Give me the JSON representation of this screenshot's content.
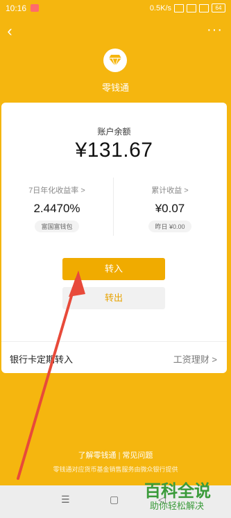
{
  "status_bar": {
    "time": "10:16",
    "network_speed": "0.5K/s",
    "battery": "64"
  },
  "header": {
    "back_icon": "chevron-left-icon",
    "more_icon": "more-dots-icon",
    "logo_icon": "diamond-icon",
    "title": "零钱通"
  },
  "balance": {
    "label": "账户余额",
    "value": "¥131.67"
  },
  "stats": {
    "yield_label": "7日年化收益率 >",
    "yield_value": "2.4470%",
    "fund_chip": "富国富钱包",
    "total_label": "累计收益 >",
    "total_value": "¥0.07",
    "yesterday_chip": "昨日 ¥0.00"
  },
  "actions": {
    "transfer_in": "转入",
    "transfer_out": "转出"
  },
  "row": {
    "left_label": "银行卡定期转入",
    "right_label": "工资理财 >"
  },
  "footer": {
    "link1": "了解零钱通",
    "sep": "|",
    "link2": "常见问题",
    "note": "零钱通对应货币基金销售服务由微众银行提供"
  },
  "navbar": {
    "menu_icon": "menu-icon",
    "home_icon": "home-icon",
    "back_icon": "back-icon"
  },
  "watermark": {
    "line1": "百科全说",
    "line2": "助你轻松解决"
  },
  "colors": {
    "background": "#f5b60f",
    "primary_button": "#f0ab00",
    "arrow": "#e84a3a"
  }
}
